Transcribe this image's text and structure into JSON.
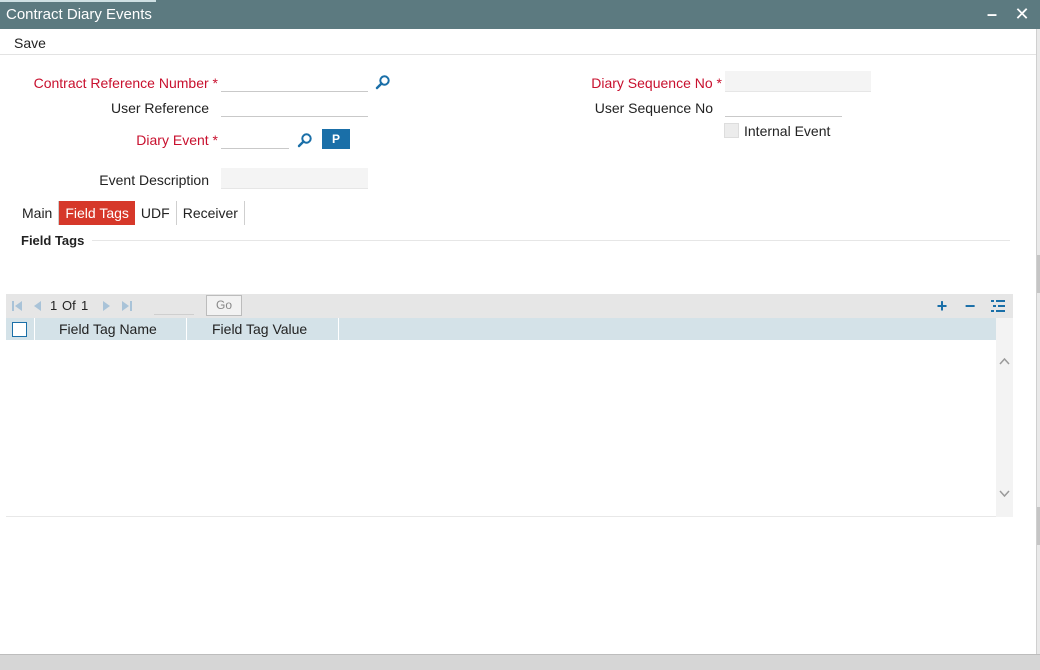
{
  "window": {
    "title": "Contract Diary Events",
    "minimize_glyph": "–",
    "close_glyph": "✕"
  },
  "toolbar": {
    "save_label": "Save"
  },
  "form": {
    "contract_ref_label": "Contract Reference Number",
    "user_reference_label": "User Reference",
    "diary_event_label": "Diary Event",
    "p_button_label": "P",
    "event_description_label": "Event Description",
    "diary_sequence_label": "Diary Sequence No",
    "user_sequence_label": "User Sequence No",
    "internal_event_label": "Internal Event",
    "required_marker": "*"
  },
  "tabs": [
    {
      "label": "Main",
      "active": false
    },
    {
      "label": "Field Tags",
      "active": true
    },
    {
      "label": "UDF",
      "active": false
    },
    {
      "label": "Receiver",
      "active": false
    }
  ],
  "section": {
    "title": "Field Tags"
  },
  "grid": {
    "pager": {
      "current": "1",
      "of_label": "Of",
      "total": "1",
      "go_label": "Go"
    },
    "columns": [
      "Field Tag Name",
      "Field Tag Value"
    ],
    "rows": []
  },
  "icons": {
    "lookup": "magnifier-icon",
    "first": "first-page-icon",
    "prev": "previous-page-icon",
    "next": "next-page-icon",
    "last": "last-page-icon",
    "add": "plus-icon",
    "delete": "minus-icon",
    "view": "list-view-icon"
  },
  "colors": {
    "titlebar": "#5c7a80",
    "required": "#c8102e",
    "active_tab": "#d6382a",
    "primary_button": "#1a6fa8",
    "grid_header": "#d4e2e8"
  }
}
